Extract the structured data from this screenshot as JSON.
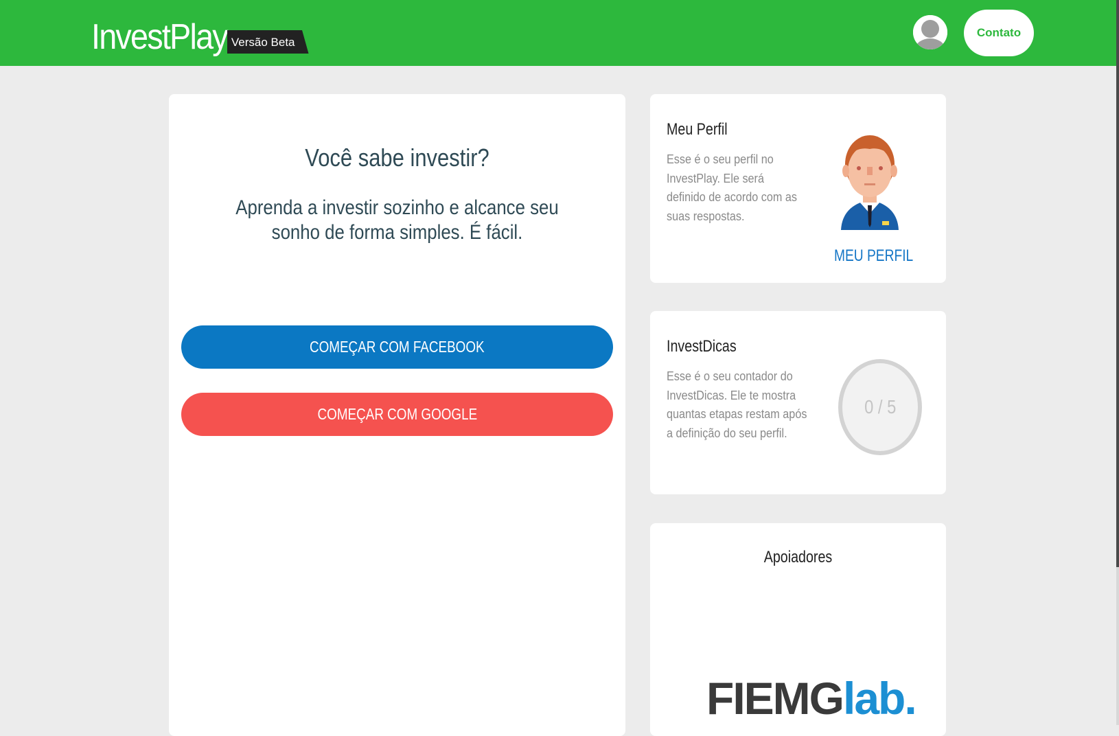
{
  "header": {
    "brand_name": "InvestPlay",
    "beta_label": "Versão Beta",
    "contact_label": "Contato",
    "avatar_icon": "user-avatar-icon",
    "background_color": "#2db83d"
  },
  "main": {
    "title": "Você sabe investir?",
    "subtitle": "Aprenda a investir sozinho e alcance seu sonho de forma simples. É fácil.",
    "facebook_button": "COMEÇAR COM FACEBOOK",
    "google_button": "COMEÇAR COM GOOGLE",
    "facebook_color": "#0b78c3",
    "google_color": "#f5524f"
  },
  "profile_card": {
    "title": "Meu Perfil",
    "description": "Esse é o seu perfil no InvestPlay. Ele será definido de acordo com as suas respostas.",
    "link_label": "MEU PERFIL",
    "illustration": "investor-avatar-illustration"
  },
  "tips_card": {
    "title": "InvestDicas",
    "description": "Esse é o seu contador do InvestDicas. Ele te mostra quantas etapas restam após a definição do seu perfil.",
    "counter": "0 / 5"
  },
  "sponsors_card": {
    "title": "Apoiadores",
    "logo_part1": "FIEMG",
    "logo_part2": "lab."
  }
}
